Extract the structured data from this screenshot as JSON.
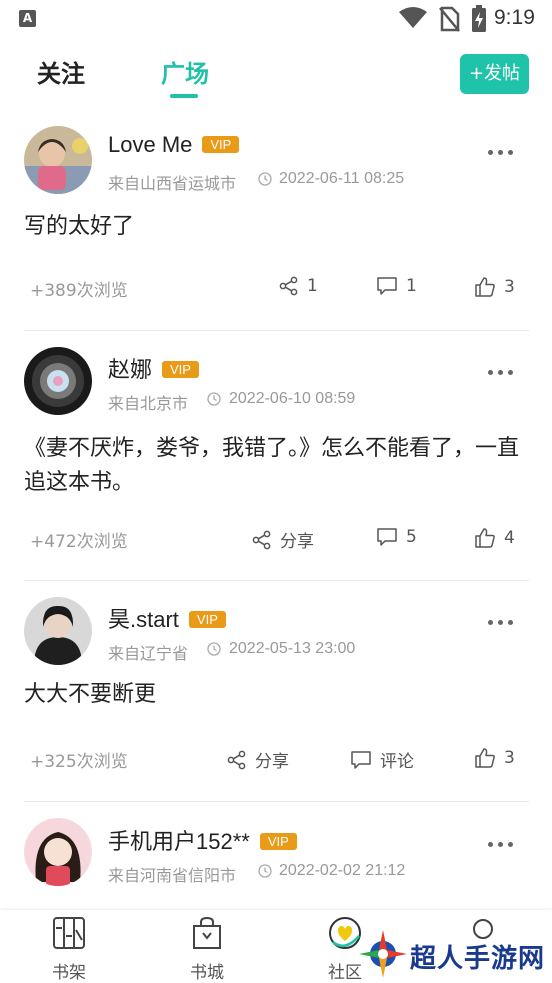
{
  "status_bar": {
    "time": "9:19"
  },
  "header": {
    "tabs": [
      {
        "label": "关注",
        "active": false
      },
      {
        "label": "广场",
        "active": true
      }
    ],
    "post_button": "+发帖",
    "accent_color": "#20c1a8"
  },
  "posts": [
    {
      "username": "Love Me",
      "vip": "VIP",
      "location": "来自山西省运城市",
      "time": "2022-06-11 08:25",
      "content": "写的太好了",
      "views": "+389次浏览",
      "share": "1",
      "comments": "1",
      "likes": "3"
    },
    {
      "username": "赵娜",
      "vip": "VIP",
      "location": "来自北京市",
      "time": "2022-06-10 08:59",
      "content": "《妻不厌炸，娄爷，我错了。》怎么不能看了，一直追这本书。",
      "views": "+472次浏览",
      "share": "分享",
      "comments": "5",
      "likes": "4"
    },
    {
      "username": "昊.start",
      "vip": "VIP",
      "location": "来自辽宁省",
      "time": "2022-05-13 23:00",
      "content": "大大不要断更",
      "views": "+325次浏览",
      "share": "分享",
      "comments": "评论",
      "likes": "3"
    },
    {
      "username": "手机用户152**",
      "vip": "VIP",
      "location": "来自河南省信阳市",
      "time": "2022-02-02 21:12"
    }
  ],
  "bottom_nav": [
    {
      "label": "书架",
      "icon": "bookshelf-icon"
    },
    {
      "label": "书城",
      "icon": "bookstore-icon"
    },
    {
      "label": "社区",
      "icon": "community-icon"
    },
    {
      "label": "",
      "icon": "profile-icon"
    }
  ],
  "watermark": "超人手游网"
}
